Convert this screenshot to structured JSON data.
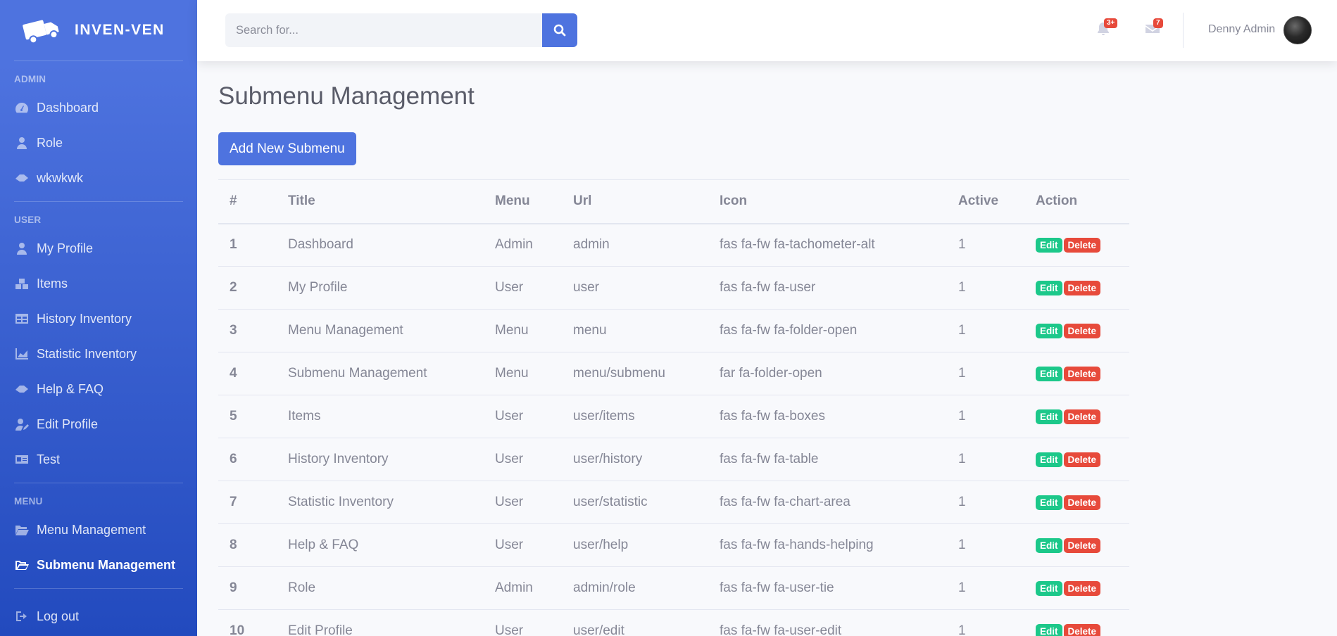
{
  "brand": {
    "name": "INVEN-VEN",
    "icon": "truck-icon"
  },
  "sidebar": {
    "sections": [
      {
        "heading": "ADMIN",
        "items": [
          {
            "label": "Dashboard",
            "icon": "tachometer-icon"
          },
          {
            "label": "Role",
            "icon": "user-tie-icon"
          },
          {
            "label": "wkwkwk",
            "icon": "hands-helping-icon"
          }
        ]
      },
      {
        "heading": "USER",
        "items": [
          {
            "label": "My Profile",
            "icon": "user-icon"
          },
          {
            "label": "Items",
            "icon": "boxes-icon"
          },
          {
            "label": "History Inventory",
            "icon": "table-icon"
          },
          {
            "label": "Statistic Inventory",
            "icon": "chart-area-icon"
          },
          {
            "label": "Help & FAQ",
            "icon": "hands-helping-icon"
          },
          {
            "label": "Edit Profile",
            "icon": "user-edit-icon"
          },
          {
            "label": "Test",
            "icon": "id-card-icon"
          }
        ]
      },
      {
        "heading": "MENU",
        "items": [
          {
            "label": "Menu Management",
            "icon": "folder-open-icon"
          },
          {
            "label": "Submenu Management",
            "icon": "folder-open-outline-icon",
            "active": true
          }
        ]
      }
    ],
    "logout": "Log out"
  },
  "topbar": {
    "search_placeholder": "Search for...",
    "alerts_badge": "3+",
    "messages_badge": "7",
    "user_name": "Denny Admin"
  },
  "page": {
    "title": "Submenu Management",
    "add_button": "Add New Submenu"
  },
  "table": {
    "headers": [
      "#",
      "Title",
      "Menu",
      "Url",
      "Icon",
      "Active",
      "Action"
    ],
    "edit_label": "Edit",
    "delete_label": "Delete",
    "rows": [
      [
        "1",
        "Dashboard",
        "Admin",
        "admin",
        "fas fa-fw fa-tachometer-alt",
        "1"
      ],
      [
        "2",
        "My Profile",
        "User",
        "user",
        "fas fa-fw fa-user",
        "1"
      ],
      [
        "3",
        "Menu Management",
        "Menu",
        "menu",
        "fas fa-fw fa-folder-open",
        "1"
      ],
      [
        "4",
        "Submenu Management",
        "Menu",
        "menu/submenu",
        "far fa-folder-open",
        "1"
      ],
      [
        "5",
        "Items",
        "User",
        "user/items",
        "fas fa-fw fa-boxes",
        "1"
      ],
      [
        "6",
        "History Inventory",
        "User",
        "user/history",
        "fas fa-fw fa-table",
        "1"
      ],
      [
        "7",
        "Statistic Inventory",
        "User",
        "user/statistic",
        "fas fa-fw fa-chart-area",
        "1"
      ],
      [
        "8",
        "Help & FAQ",
        "User",
        "user/help",
        "fas fa-fw fa-hands-helping",
        "1"
      ],
      [
        "9",
        "Role",
        "Admin",
        "admin/role",
        "fas fa-fw fa-user-tie",
        "1"
      ],
      [
        "10",
        "Edit Profile",
        "User",
        "user/edit",
        "fas fa-fw fa-user-edit",
        "1"
      ]
    ]
  },
  "colors": {
    "primary": "#4e73df",
    "success": "#1cc88a",
    "danger": "#e74a3b"
  }
}
